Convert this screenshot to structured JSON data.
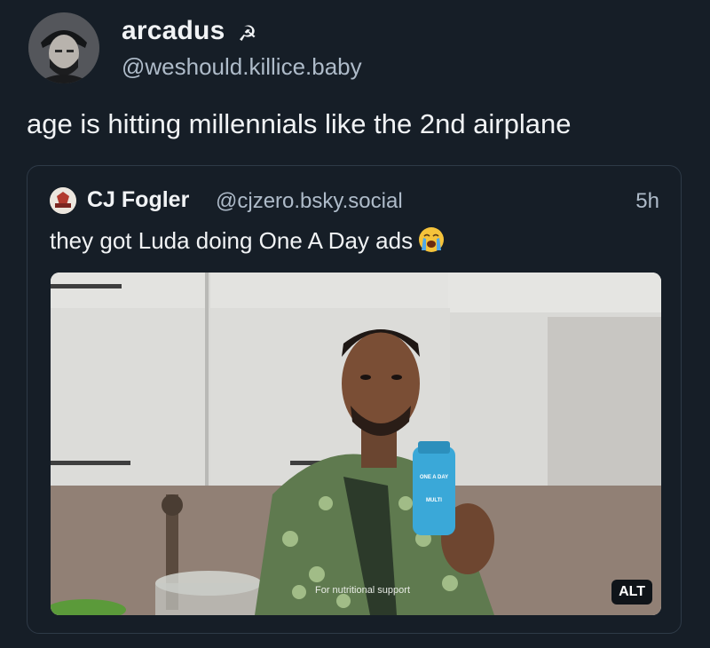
{
  "author": {
    "display_name": "arcadus",
    "flag_glyph": "☭",
    "handle": "@weshould.killice.baby",
    "avatar_icon": "avatar-photo"
  },
  "post": {
    "text": "age is hitting millennials like the 2nd airplane"
  },
  "quoted_post": {
    "display_name": "CJ Fogler",
    "handle": "@cjzero.bsky.social",
    "timestamp": "5h",
    "text": "they got Luda doing One A Day ads",
    "emoji_icon": "loudly-crying-face-emoji",
    "image": {
      "alt_label": "ALT",
      "bottle_brand": "ONE A DAY",
      "bottle_product": "MULTI",
      "caption": "For nutritional support"
    }
  },
  "colors": {
    "background": "#161e27",
    "text_primary": "#f1f3f5",
    "text_secondary": "#aebbc9",
    "card_border": "#2e3a47"
  }
}
